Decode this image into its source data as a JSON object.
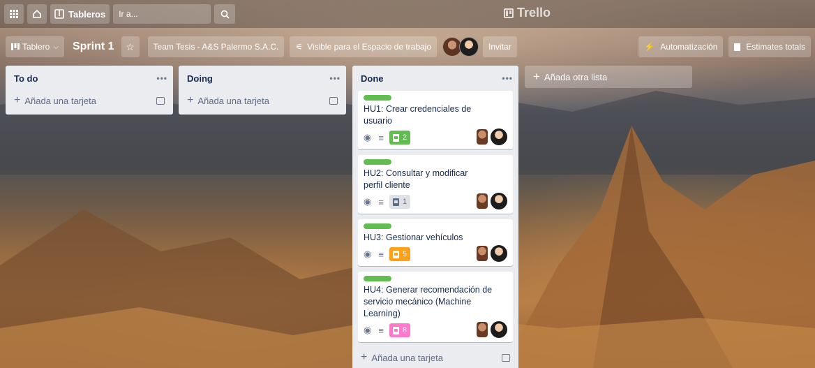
{
  "topbar": {
    "boards_label": "Tableros",
    "search_placeholder": "Ir a...",
    "logo_text": "Trello"
  },
  "board_header": {
    "view_label": "Tablero",
    "board_name": "Sprint 1",
    "team_label": "Team Tesis - A&S Palermo S.A.C.",
    "visibility_label": "Visible para el Espacio de trabajo",
    "invite_label": "Invitar",
    "automation_label": "Automatización",
    "estimates_label": "Estimates totals"
  },
  "lists": [
    {
      "name": "To do",
      "add_card_label": "Añada una tarjeta",
      "cards": []
    },
    {
      "name": "Doing",
      "add_card_label": "Añada una tarjeta",
      "cards": []
    },
    {
      "name": "Done",
      "add_card_label": "Añada una tarjeta",
      "cards": [
        {
          "title": "HU1: Crear credenciales de usuario",
          "estimate": "2",
          "estimate_color": "#61bd4f",
          "label_color": "#61bd4f"
        },
        {
          "title": "HU2: Consultar y modificar perfil cliente",
          "estimate": "1",
          "estimate_color": "#dfe1e6",
          "label_color": "#61bd4f"
        },
        {
          "title": "HU3: Gestionar vehículos",
          "estimate": "5",
          "estimate_color": "#ff9f1a",
          "label_color": "#61bd4f"
        },
        {
          "title": "HU4: Generar recomendación de servicio mecánico (Machine Learning)",
          "estimate": "8",
          "estimate_color": "#ff78cb",
          "label_color": "#61bd4f"
        }
      ]
    }
  ],
  "add_list_label": "Añada otra lista",
  "icons": {
    "apps": "grid-icon",
    "home": "home-icon",
    "search": "search-icon",
    "star": "star-icon",
    "visibility": "people-icon",
    "automation": "bolt-icon",
    "estimate": "estimate-icon",
    "watch": "eye-icon",
    "description": "description-icon",
    "template": "template-icon"
  }
}
